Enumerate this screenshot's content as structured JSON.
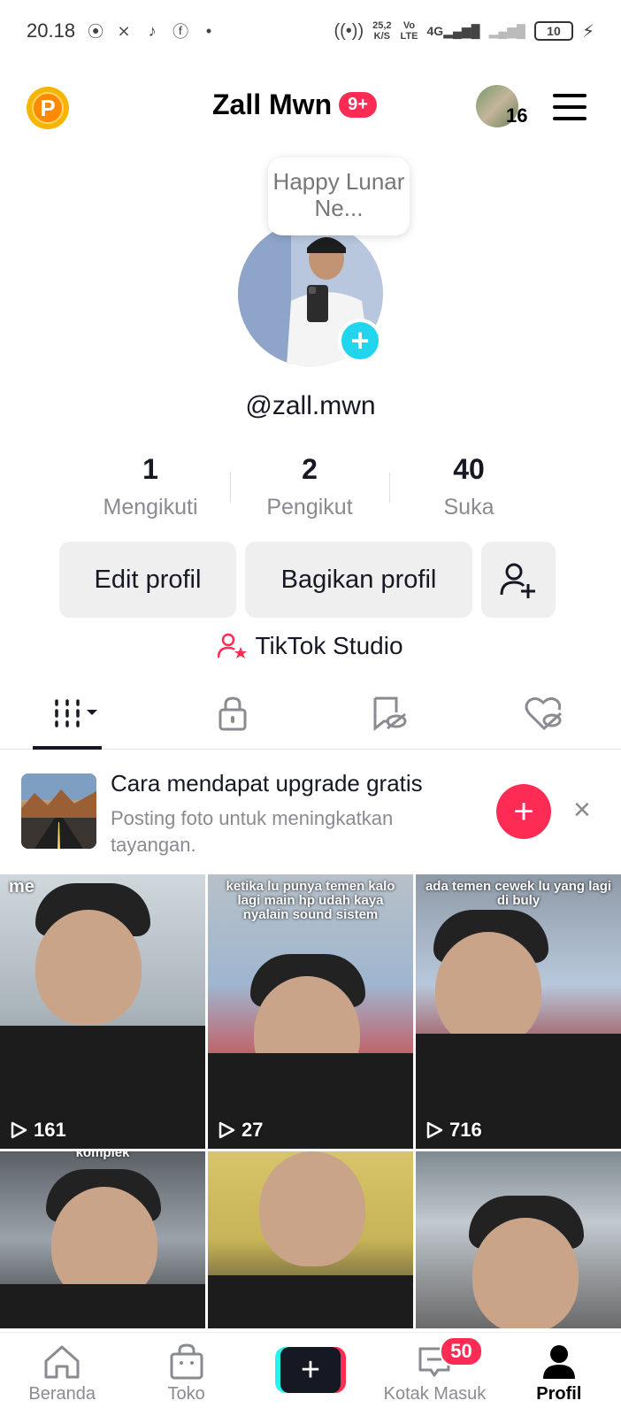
{
  "status_bar": {
    "time": "20.18",
    "net_rate_value": "25,2",
    "net_rate_unit": "K/S",
    "volte_top": "Vo",
    "volte_bottom": "LTE",
    "signal_4g": "4G",
    "battery": "10"
  },
  "header": {
    "title": "Zall Mwn",
    "notification_badge": "9+",
    "friends_count": "16",
    "coin_letter": "P"
  },
  "profile": {
    "bubble_text": "Happy Lunar Ne...",
    "username": "@zall.mwn",
    "avatar_add_symbol": "+"
  },
  "stats": [
    {
      "value": "1",
      "label": "Mengikuti"
    },
    {
      "value": "2",
      "label": "Pengikut"
    },
    {
      "value": "40",
      "label": "Suka"
    }
  ],
  "buttons": {
    "edit_profile": "Edit profil",
    "share_profile": "Bagikan profil"
  },
  "studio": {
    "label": "TikTok Studio"
  },
  "tabs": [
    "videos-grid-tab",
    "private-tab",
    "reposts-tab",
    "liked-tab"
  ],
  "promo": {
    "title": "Cara mendapat upgrade gratis",
    "subtitle": "Posting foto untuk meningkatkan tayangan.",
    "add_symbol": "+",
    "close_symbol": "×"
  },
  "videos": [
    {
      "overlay": "me",
      "views": "161"
    },
    {
      "overlay": "ketika lu punya temen kalo lagi main hp udah kaya nyalain sound sistem",
      "views": "27"
    },
    {
      "overlay": "ada temen cewek lu yang lagi di buly",
      "views": "716"
    },
    {
      "overlay": "komplek",
      "views": ""
    },
    {
      "overlay": "",
      "views": ""
    },
    {
      "overlay": "",
      "views": ""
    }
  ],
  "nav": {
    "home": "Beranda",
    "shop": "Toko",
    "create_symbol": "+",
    "inbox": "Kotak Masuk",
    "inbox_badge": "50",
    "profile": "Profil"
  },
  "colors": {
    "accent": "#fe2c55",
    "cyan": "#25f4ee",
    "text": "#161823",
    "muted": "#8a8b91"
  }
}
